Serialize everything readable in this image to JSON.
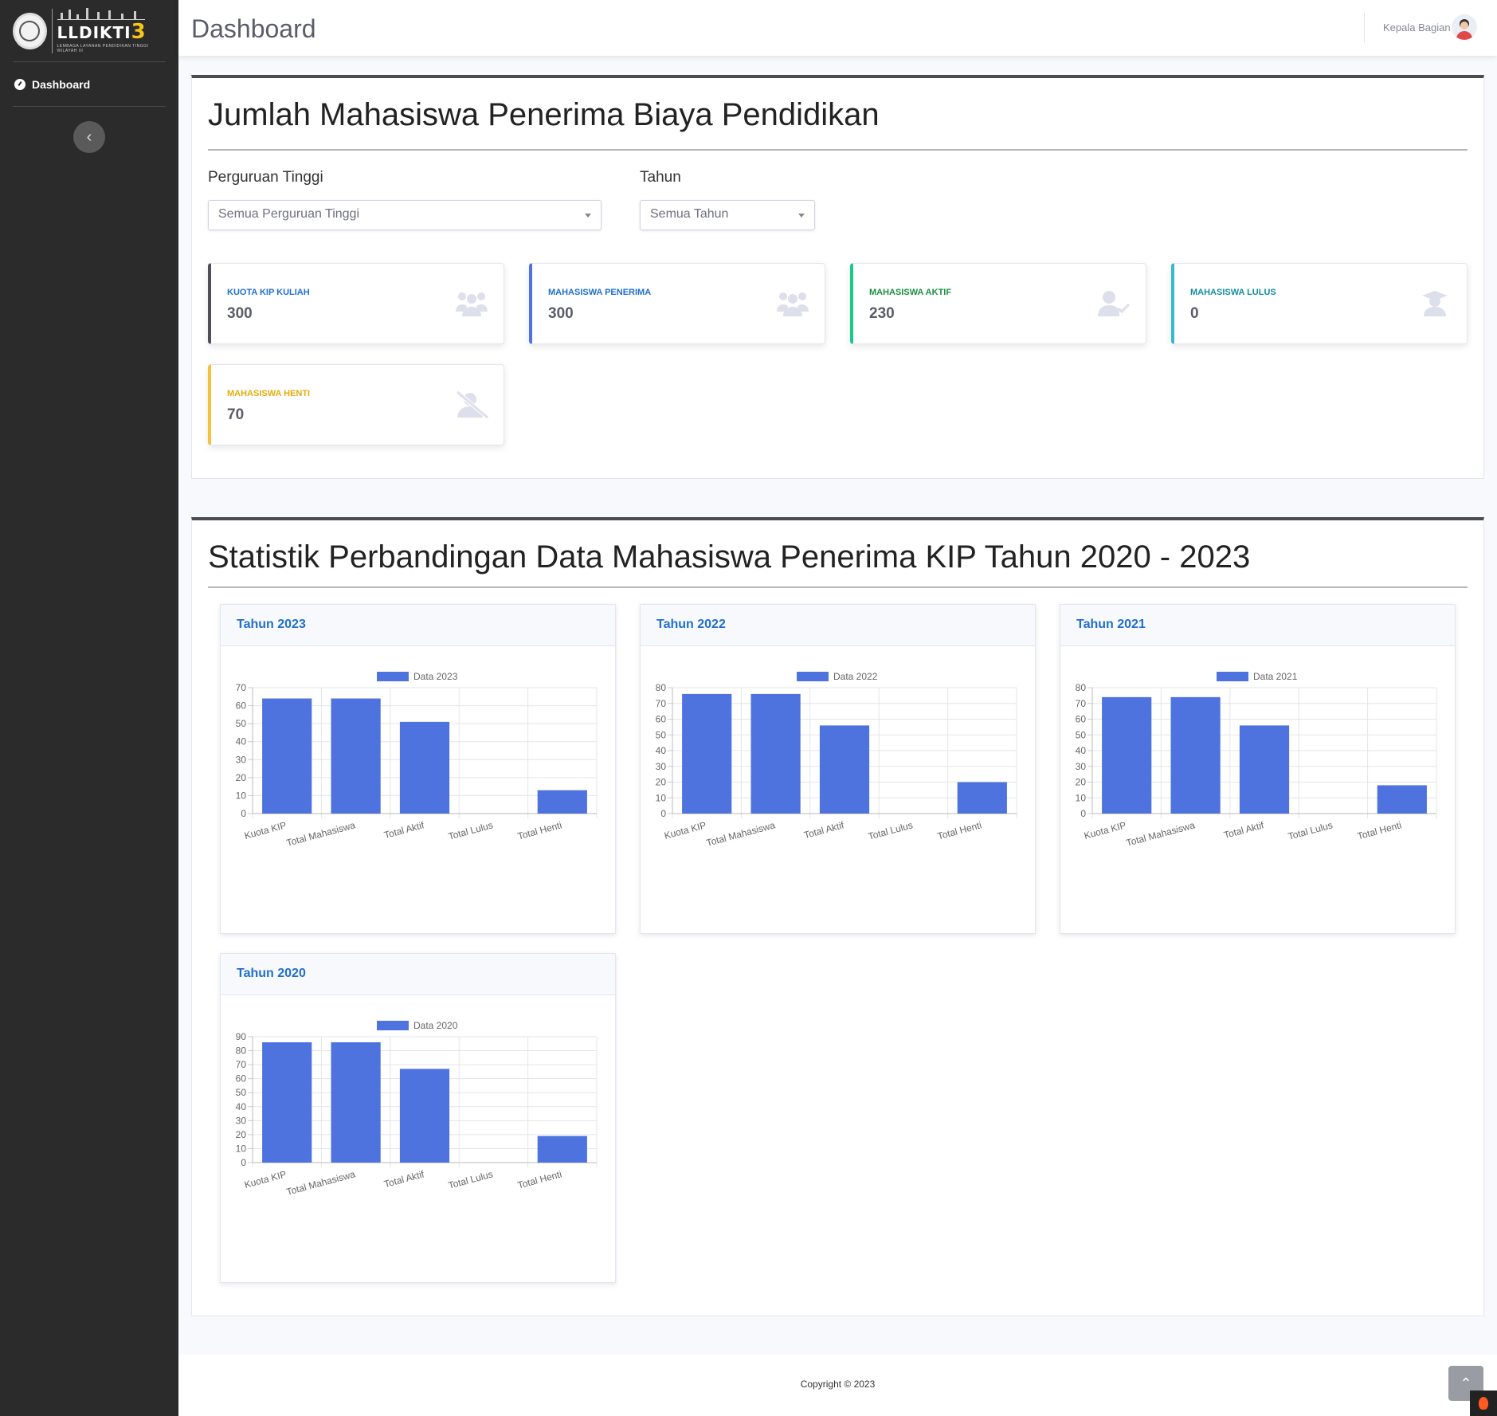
{
  "sidebar": {
    "logo": {
      "brand_main": "LLDIKTI",
      "brand_number": "3",
      "brand_sub": "LEMBAGA LAYANAN PENDIDIKAN TINGGI WILAYAH III"
    },
    "items": [
      {
        "label": "Dashboard",
        "icon": "tachometer-icon",
        "active": true
      }
    ],
    "toggle_icon": "chevron-left-icon"
  },
  "topbar": {
    "title": "Dashboard",
    "user_name": "Kepala Bagian"
  },
  "summary": {
    "title": "Jumlah Mahasiswa Penerima Biaya Pendidikan",
    "filters": {
      "institution_label": "Perguruan Tinggi",
      "institution_value": "Semua Perguruan Tinggi",
      "year_label": "Tahun",
      "year_value": "Semua Tahun"
    },
    "stats": [
      {
        "label": "KUOTA KIP KULIAH",
        "value": "300",
        "color": "#4e4f57",
        "label_color": "#1f6fd1",
        "icon": "users-icon"
      },
      {
        "label": "MAHASISWA PENERIMA",
        "value": "300",
        "color": "#4e73df",
        "label_color": "#1f6fd1",
        "icon": "users-icon"
      },
      {
        "label": "MAHASISWA AKTIF",
        "value": "230",
        "color": "#1cc88a",
        "label_color": "#1a8f43",
        "icon": "user-check-icon"
      },
      {
        "label": "MAHASISWA LULUS",
        "value": "0",
        "color": "#36b9cc",
        "label_color": "#138da1",
        "icon": "user-graduate-icon"
      },
      {
        "label": "MAHASISWA HENTI",
        "value": "70",
        "color": "#f6c23e",
        "label_color": "#e5ac0e",
        "icon": "user-slash-icon"
      }
    ]
  },
  "statistics": {
    "title": "Statistik Perbandingan Data Mahasiswa Penerima KIP Tahun 2020 - 2023"
  },
  "chart_data": [
    {
      "type": "bar",
      "title": "Tahun 2023",
      "categories": [
        "Kuota KIP",
        "Total Mahasiswa",
        "Total Aktif",
        "Total Lulus",
        "Total Henti"
      ],
      "series": [
        {
          "name": "Data 2023",
          "values": [
            64,
            64,
            51,
            0,
            13
          ],
          "color": "#4e73df"
        }
      ],
      "ylim": [
        0,
        70
      ],
      "yticks": [
        0,
        10,
        20,
        30,
        40,
        50,
        60,
        70
      ],
      "legend": "top",
      "grid": true
    },
    {
      "type": "bar",
      "title": "Tahun 2022",
      "categories": [
        "Kuota KIP",
        "Total Mahasiswa",
        "Total Aktif",
        "Total Lulus",
        "Total Henti"
      ],
      "series": [
        {
          "name": "Data 2022",
          "values": [
            76,
            76,
            56,
            0,
            20
          ],
          "color": "#4e73df"
        }
      ],
      "ylim": [
        0,
        80
      ],
      "yticks": [
        0,
        10,
        20,
        30,
        40,
        50,
        60,
        70,
        80
      ],
      "legend": "top",
      "grid": true
    },
    {
      "type": "bar",
      "title": "Tahun 2021",
      "categories": [
        "Kuota KIP",
        "Total Mahasiswa",
        "Total Aktif",
        "Total Lulus",
        "Total Henti"
      ],
      "series": [
        {
          "name": "Data 2021",
          "values": [
            74,
            74,
            56,
            0,
            18
          ],
          "color": "#4e73df"
        }
      ],
      "ylim": [
        0,
        80
      ],
      "yticks": [
        0,
        10,
        20,
        30,
        40,
        50,
        60,
        70,
        80
      ],
      "legend": "top",
      "grid": true
    },
    {
      "type": "bar",
      "title": "Tahun 2020",
      "categories": [
        "Kuota KIP",
        "Total Mahasiswa",
        "Total Aktif",
        "Total Lulus",
        "Total Henti"
      ],
      "series": [
        {
          "name": "Data 2020",
          "values": [
            86,
            86,
            67,
            0,
            19
          ],
          "color": "#4e73df"
        }
      ],
      "ylim": [
        0,
        90
      ],
      "yticks": [
        0,
        10,
        20,
        30,
        40,
        50,
        60,
        70,
        80,
        90
      ],
      "legend": "top",
      "grid": true
    }
  ],
  "footer": {
    "copyright": "Copyright © 2023"
  }
}
